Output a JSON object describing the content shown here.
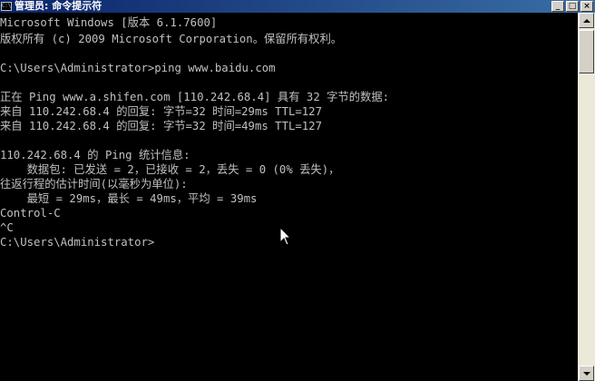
{
  "window": {
    "title": "管理员: 命令提示符",
    "icon_glyph": "C:\\",
    "controls": {
      "minimize": "_",
      "maximize": "□",
      "close": "×"
    }
  },
  "console": {
    "lines": [
      "Microsoft Windows [版本 6.1.7600]",
      "版权所有 (c) 2009 Microsoft Corporation。保留所有权利。",
      "",
      "C:\\Users\\Administrator>ping www.baidu.com",
      "",
      "正在 Ping www.a.shifen.com [110.242.68.4] 具有 32 字节的数据:",
      "来自 110.242.68.4 的回复: 字节=32 时间=29ms TTL=127",
      "来自 110.242.68.4 的回复: 字节=32 时间=49ms TTL=127",
      "",
      "110.242.68.4 的 Ping 统计信息:",
      "    数据包: 已发送 = 2，已接收 = 2，丢失 = 0 (0% 丢失)，",
      "往返行程的估计时间(以毫秒为单位):",
      "    最短 = 29ms，最长 = 49ms，平均 = 39ms",
      "Control-C",
      "^C",
      "C:\\Users\\Administrator>"
    ]
  },
  "colors": {
    "console_background": "#000000",
    "console_text": "#c0c0c0",
    "titlebar": "#0a246a"
  },
  "icons": [
    "cmd-app-icon",
    "mouse-cursor-icon",
    "scroll-up-arrow-icon",
    "scroll-down-arrow-icon"
  ]
}
